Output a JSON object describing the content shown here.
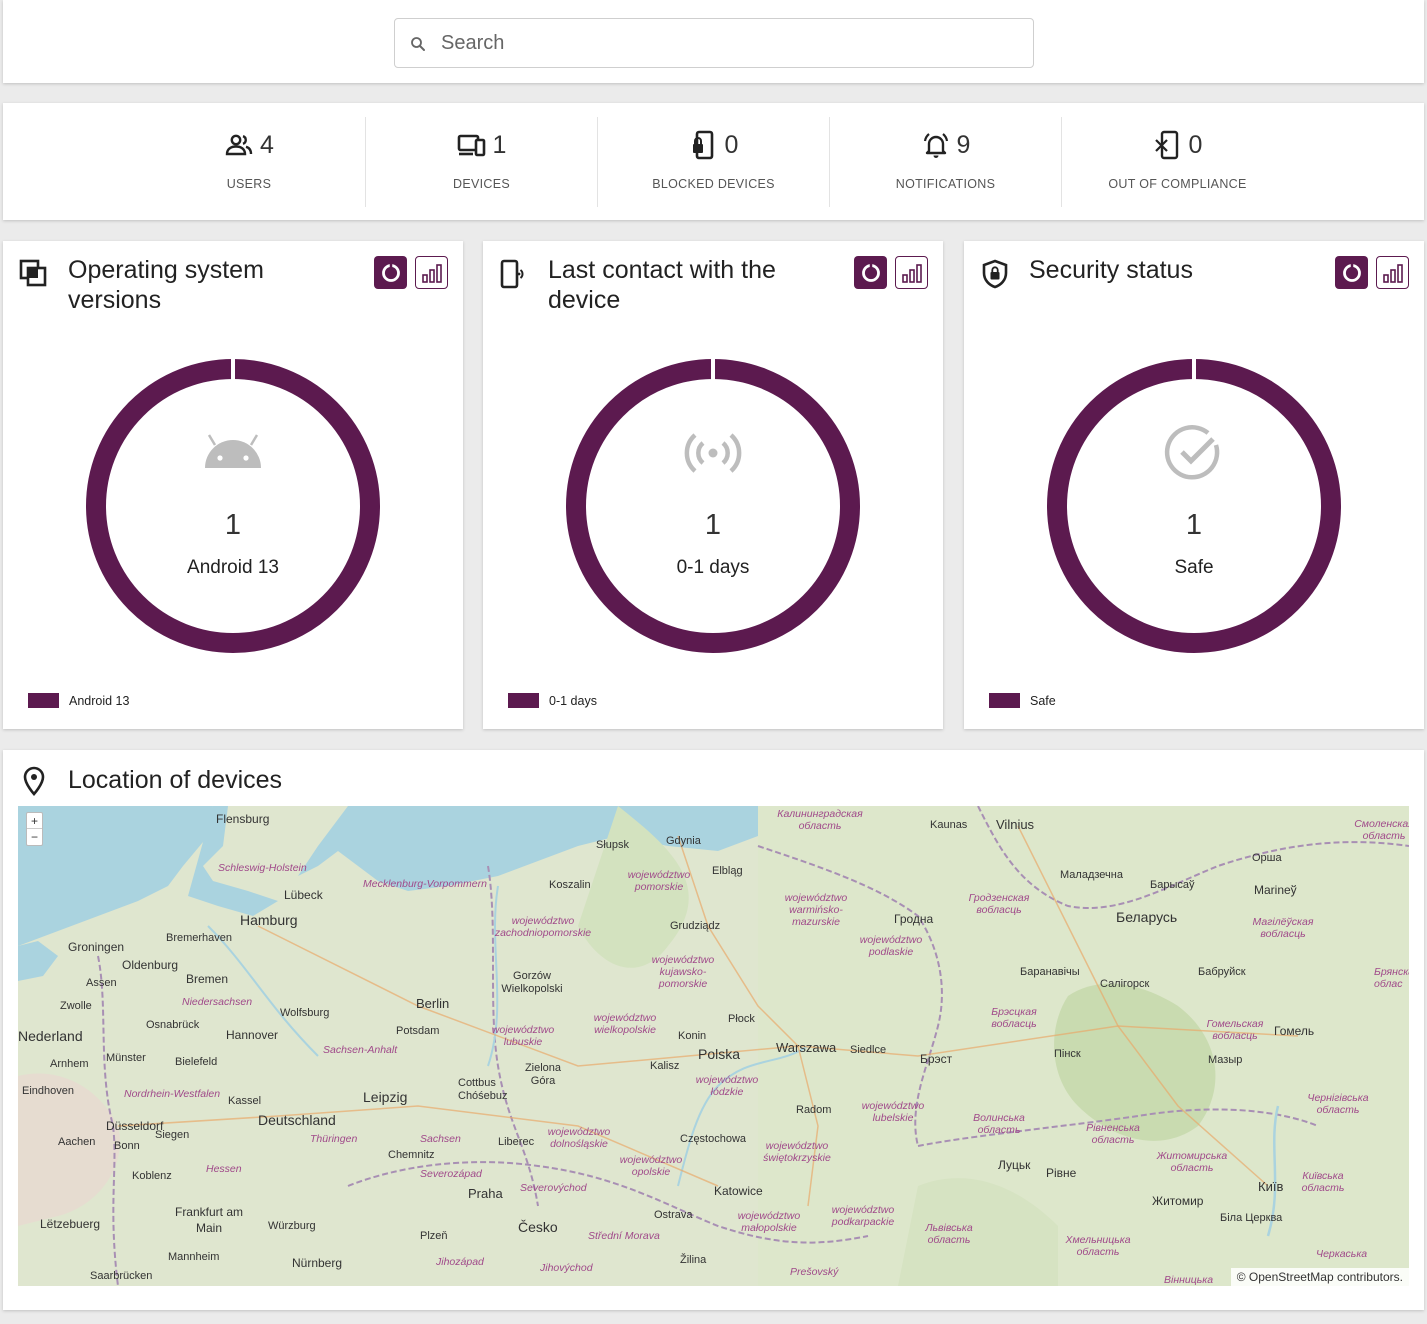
{
  "search": {
    "placeholder": "Search"
  },
  "stats": [
    {
      "icon": "users-icon",
      "value": "4",
      "label": "USERS"
    },
    {
      "icon": "devices-icon",
      "value": "1",
      "label": "DEVICES"
    },
    {
      "icon": "blocked-device-icon",
      "value": "0",
      "label": "BLOCKED DEVICES"
    },
    {
      "icon": "bell-icon",
      "value": "9",
      "label": "NOTIFICATIONS"
    },
    {
      "icon": "noncompliant-device-icon",
      "value": "0",
      "label": "OUT OF COMPLIANCE"
    }
  ],
  "cards": {
    "os": {
      "title": "Operating system versions",
      "count": "1",
      "label": "Android 13",
      "legend": "Android 13",
      "center_icon": "android-icon"
    },
    "contact": {
      "title": "Last contact with the device",
      "count": "1",
      "label": "0-1 days",
      "legend": "0-1 days",
      "center_icon": "signal-icon"
    },
    "security": {
      "title": "Security status",
      "count": "1",
      "label": "Safe",
      "legend": "Safe",
      "center_icon": "check-circle-icon"
    }
  },
  "colors": {
    "accent": "#5c1a4f",
    "map_water": "#aad3df",
    "map_land": "#dfe6cf"
  },
  "map": {
    "title": "Location of devices",
    "zoom_in": "+",
    "zoom_out": "−",
    "attribution_prefix": "© ",
    "attribution_link": "OpenStreetMap",
    "attribution_suffix": " contributors.",
    "labels": {
      "flensburg": "Flensburg",
      "schleswig": "Schleswig-Holstein",
      "lubeck": "Lübeck",
      "mecklenburg": "Mecklenburg-Vorpommern",
      "hamburg": "Hamburg",
      "bremerhaven": "Bremerhaven",
      "groningen": "Groningen",
      "oldenburg": "Oldenburg",
      "assen": "Assen",
      "bremen": "Bremen",
      "niedersachsen": "Niedersachsen",
      "zwolle": "Zwolle",
      "osnabruck": "Osnabrück",
      "wolfsburg": "Wolfsburg",
      "berlin": "Berlin",
      "potsdam": "Potsdam",
      "nederland": "Nederland",
      "hannover": "Hannover",
      "munster": "Münster",
      "bielefeld": "Bielefeld",
      "sachsenanhalt": "Sachsen-Anhalt",
      "arnhem": "Arnhem",
      "eindhoven": "Eindhoven",
      "nrw": "Nordrhein-Westfalen",
      "kassel": "Kassel",
      "leipzig": "Leipzig",
      "deutschland": "Deutschland",
      "dusseldorf": "Düsseldorf",
      "aachen": "Aachen",
      "bonn": "Bonn",
      "siegen": "Siegen",
      "thuringen": "Thüringen",
      "sachsen": "Sachsen",
      "chemnitz": "Chemnitz",
      "koblenz": "Koblenz",
      "hessen": "Hessen",
      "frankfurt": "Frankfurt am Main",
      "wurzburg": "Würzburg",
      "letzebuerg": "Lëtzebuerg",
      "mannheim": "Mannheim",
      "saarbrucken": "Saarbrücken",
      "nurnberg": "Nürnberg",
      "plzen": "Plzeň",
      "praha": "Praha",
      "cesko": "Česko",
      "liberec": "Liberec",
      "cottbus": "Cottbus Chóśebuz",
      "zielona": "Zielona Góra",
      "gorzow": "Gorzów Wielkopolski",
      "szczecin_reg": "województwo zachodniopomorskie",
      "koszalin": "Koszalin",
      "slupsk": "Słupsk",
      "gdynia": "Gdynia",
      "elblag": "Elbląg",
      "pomorskie": "województwo pomorskie",
      "grudziadz": "Grudziądz",
      "kujawsko": "województwo kujawsko-pomorskie",
      "lubuskie": "województwo lubuskie",
      "wielkopolskie": "województwo wielkopolskie",
      "konin": "Konin",
      "plock": "Płock",
      "polska": "Polska",
      "warszawa": "Warszawa",
      "kalisz": "Kalisz",
      "lodzkie": "województwo łódzkie",
      "siedlce": "Siedlce",
      "radom": "Radom",
      "dolnoslaskie": "województwo dolnośląskie",
      "opolskie": "województwo opolskie",
      "czestochowa": "Częstochowa",
      "swietokrzyskie": "województwo świętokrzyskie",
      "katowice": "Katowice",
      "ostrava": "Ostrava",
      "malopolskie": "województwo małopolskie",
      "podkarpackie": "województwo podkarpackie",
      "lubelskie": "województwo lubelskie",
      "warminsko": "województwo warmińsko-mazurskie",
      "podlaskie": "województwo podlaskie",
      "kaliningrad": "Калининградская область",
      "kaunas": "Kaunas",
      "vilnius": "Vilnius",
      "hrodna": "Гродна",
      "hrodna_reg": "Гродзенская вобласць",
      "maladzechna": "Маладзечна",
      "barysau": "Барысаў",
      "orsha": "Орша",
      "belarus": "Беларусь",
      "marineu": "Marineў",
      "mahilyow_reg": "Магілёўская вобласць",
      "smolensk_reg": "Смоленская область",
      "baranavichy": "Баранавічы",
      "salihorsk": "Салігорск",
      "babruisk": "Бабруйск",
      "brest_reg": "Брэсцкая вобласць",
      "brest": "Брэст",
      "pinsk": "Пінск",
      "homel_reg": "Гомельская вобласць",
      "homel": "Гомель",
      "mazyr": "Мазыр",
      "volyn_reg": "Волинська область",
      "lutsk": "Луцьк",
      "rivne_reg": "Рівненська область",
      "rivne": "Рівне",
      "zhytomyr_reg": "Житомирська область",
      "zhytomyr": "Житомир",
      "kyiv": "Київ",
      "kyiv_reg": "Київська область",
      "chernihiv_reg": "Чернігівська область",
      "bila": "Біла Церква",
      "lviv_reg": "Львівська область",
      "khmelnytskyi_reg": "Хмельницька область",
      "vinnytsia": "Вінницька",
      "cherkasy_reg": "Черкаська",
      "stredni": "Střední Morava",
      "jihozapad": "Jihozápad",
      "jihovychod": "Jihovýchod",
      "severozapad": "Severozápad",
      "severovychod": "Severovýchod",
      "zilina": "Žilina",
      "presov": "Prešovský",
      "bryansk_reg": "Брянская облас"
    }
  }
}
